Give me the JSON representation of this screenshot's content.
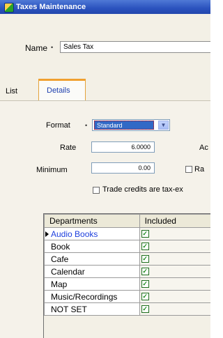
{
  "window": {
    "title": "Taxes Maintenance"
  },
  "header": {
    "name_label": "Name",
    "name_value": "Sales Tax"
  },
  "tabs": [
    {
      "label": "List"
    },
    {
      "label": "Details"
    }
  ],
  "details": {
    "format_label": "Format",
    "format_value": "Standard",
    "rate_label": "Rate",
    "rate_value": "6.0000",
    "minimum_label": "Minimum",
    "minimum_value": "0.00",
    "ac_label_partial": "Ac",
    "ra_checkbox_label_partial": "Ra",
    "trade_credits_label": "Trade credits are tax-ex"
  },
  "grid": {
    "columns": [
      "Departments",
      "Included"
    ],
    "rows": [
      {
        "department": "Audio Books",
        "included": true,
        "active": true
      },
      {
        "department": "Book",
        "included": true
      },
      {
        "department": "Cafe",
        "included": true
      },
      {
        "department": "Calendar",
        "included": true
      },
      {
        "department": "Map",
        "included": true
      },
      {
        "department": "Music/Recordings",
        "included": true
      },
      {
        "department": "NOT SET",
        "included": true
      }
    ]
  },
  "icons": {
    "app": "app-icon",
    "dropdown": "chevron-down-icon",
    "row_pointer": "row-pointer-icon",
    "checked": "checkmark-icon"
  },
  "colors": {
    "titlebar": "#2a52be",
    "active_tab_accent": "#f0a030",
    "selection": "#3169c6",
    "link_text": "#1d3fdd"
  }
}
